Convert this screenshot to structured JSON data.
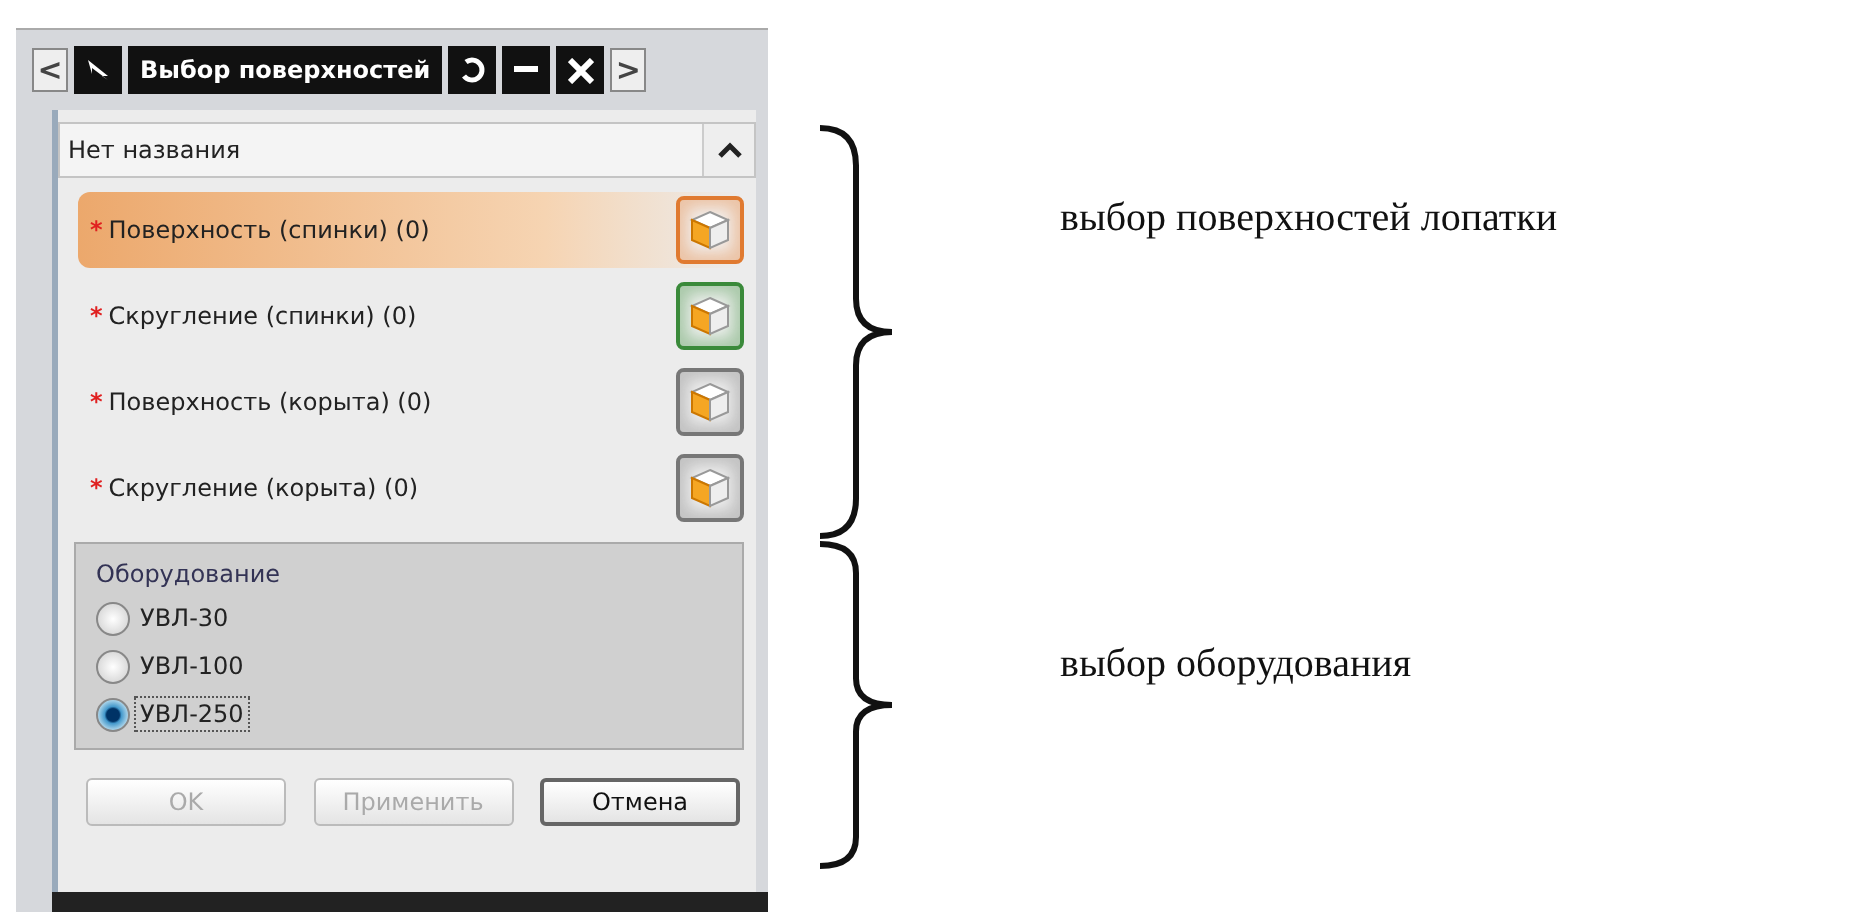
{
  "window": {
    "title": "Выбор поверхностей",
    "nav_left": "<",
    "nav_right": ">"
  },
  "section": {
    "title": "Нет названия",
    "expanded": true
  },
  "selections": [
    {
      "label": "Поверхность (спинки) (0)",
      "required_mark": "*",
      "selected": true,
      "color": "#e07a30"
    },
    {
      "label": "Скругление (спинки) (0)",
      "required_mark": "*",
      "selected": false,
      "color": "#3a8a3a"
    },
    {
      "label": "Поверхность (корыта) (0)",
      "required_mark": "*",
      "selected": false,
      "color": "#777777"
    },
    {
      "label": "Скругление (корыта) (0)",
      "required_mark": "*",
      "selected": false,
      "color": "#777777"
    }
  ],
  "equipment": {
    "title": "Оборудование",
    "options": [
      {
        "label": "УВЛ-30",
        "selected": false
      },
      {
        "label": "УВЛ-100",
        "selected": false
      },
      {
        "label": "УВЛ-250",
        "selected": true
      }
    ]
  },
  "buttons": [
    {
      "label": "OK",
      "disabled": true
    },
    {
      "label": "Применить",
      "disabled": true
    },
    {
      "label": "Отмена",
      "disabled": false
    }
  ],
  "annotations": [
    "выбор поверхностей лопатки",
    "выбор оборудования"
  ]
}
